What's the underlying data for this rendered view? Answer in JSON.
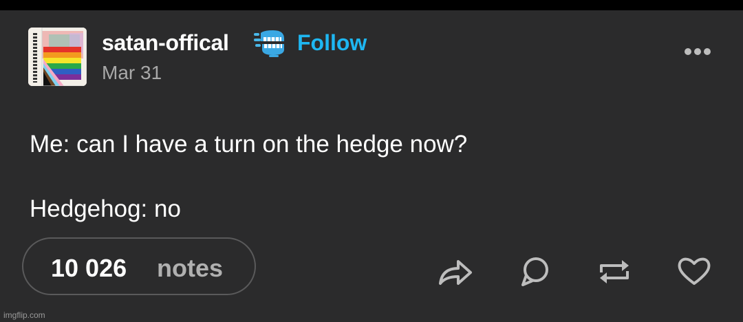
{
  "post": {
    "username": "satan-offical",
    "follow_label": "Follow",
    "date": "Mar 31",
    "body_line_1": "Me: can I have a turn on the hedge now?",
    "body_line_2": "Hedgehog: no"
  },
  "footer": {
    "notes_count": "10 026",
    "notes_label": "notes",
    "actions": [
      "share-icon",
      "reply-icon",
      "reblog-icon",
      "like-icon"
    ]
  },
  "watermark": "imgflip.com",
  "colors": {
    "background": "#2b2b2c",
    "text": "#ffffff",
    "secondary_text": "#a8a8a8",
    "accent": "#1eb7f2"
  }
}
